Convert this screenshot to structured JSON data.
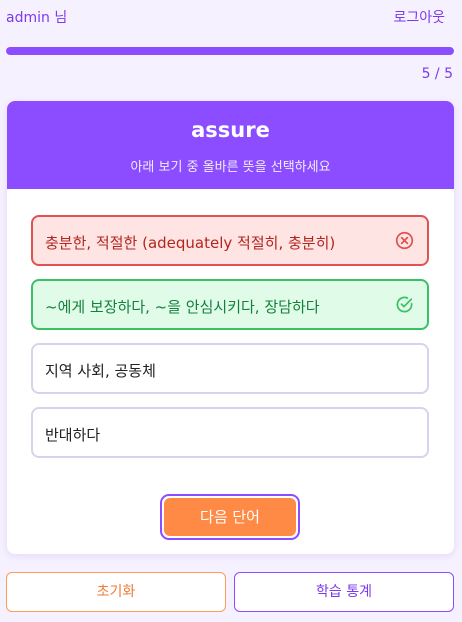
{
  "header": {
    "user_label": "admin 님",
    "logout_label": "로그아웃"
  },
  "progress": {
    "current": 5,
    "total": 5,
    "fraction": 1.0,
    "text": "5 / 5"
  },
  "card": {
    "word": "assure",
    "instruction": "아래 보기 중 올바른 뜻을 선택하세요",
    "options": [
      {
        "text": "충분한, 적절한 (adequately 적절히, 충분히)",
        "state": "wrong",
        "icon": "x-circle-icon"
      },
      {
        "text": "~에게 보장하다, ~을 안심시키다, 장담하다",
        "state": "correct",
        "icon": "check-circle-icon"
      },
      {
        "text": "지역 사회, 공동체",
        "state": "neutral"
      },
      {
        "text": "반대하다",
        "state": "neutral"
      }
    ],
    "next_label": "다음 단어"
  },
  "footer": {
    "reset_label": "초기화",
    "stats_label": "학습 통계"
  },
  "colors": {
    "accent": "#8b4dff",
    "wrong": "#e05252",
    "correct": "#3cc066",
    "next_button": "#ff8a45"
  }
}
